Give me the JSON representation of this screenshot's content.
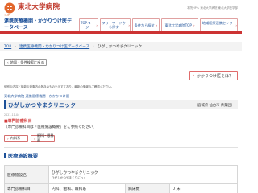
{
  "header": {
    "logo_caption": "TOP",
    "brand": "東北大学病院",
    "links": "本院HPへ  東北大学病院  東北大学医学部",
    "subtitle": "連携医療機関・かかりつけ医データベース",
    "nav": [
      {
        "label": "TOPページ"
      },
      {
        "label": "フリーワードから探す"
      },
      {
        "label": "条件から探す"
      },
      {
        "label": "東北大学病院TOP"
      },
      {
        "label": "地域医療連携センター"
      }
    ]
  },
  "breadcrumb": {
    "items": [
      "TOP",
      "連携医療機関・かかりつけ医データベース",
      "ひがしかつやまクリニック"
    ]
  },
  "back_button": "地図・条件検索に戻る",
  "about_button": "かかりつけ医とは？",
  "notice": "個別の内容と機能の対象内の各自のものを示すており、最新の情報のご確認ください。",
  "clinic": {
    "category": "東北大学病院 連携医療機関・かかりつけ医",
    "name": "ひがしかつやまクリニック",
    "area": "（宮城県 仙台市·青葉区）",
    "updated": "2021-11-04",
    "specialty_title": "専門診療科目",
    "specialty_note": "（専門診療科目は「医療施設概要」をご参照ください）",
    "tags": [
      "内科系",
      "歯科・眼科系"
    ]
  },
  "section": {
    "title": "医療施設概要",
    "rows": [
      {
        "label": "医療施設名",
        "value": "ひがしかつやまクリニック",
        "sub": "ひがしかつやまくりにっく"
      },
      {
        "label": "専門診療科目",
        "value": "内科、歯科、眼科系",
        "label2": "病床数",
        "value2": "0 床"
      }
    ]
  }
}
